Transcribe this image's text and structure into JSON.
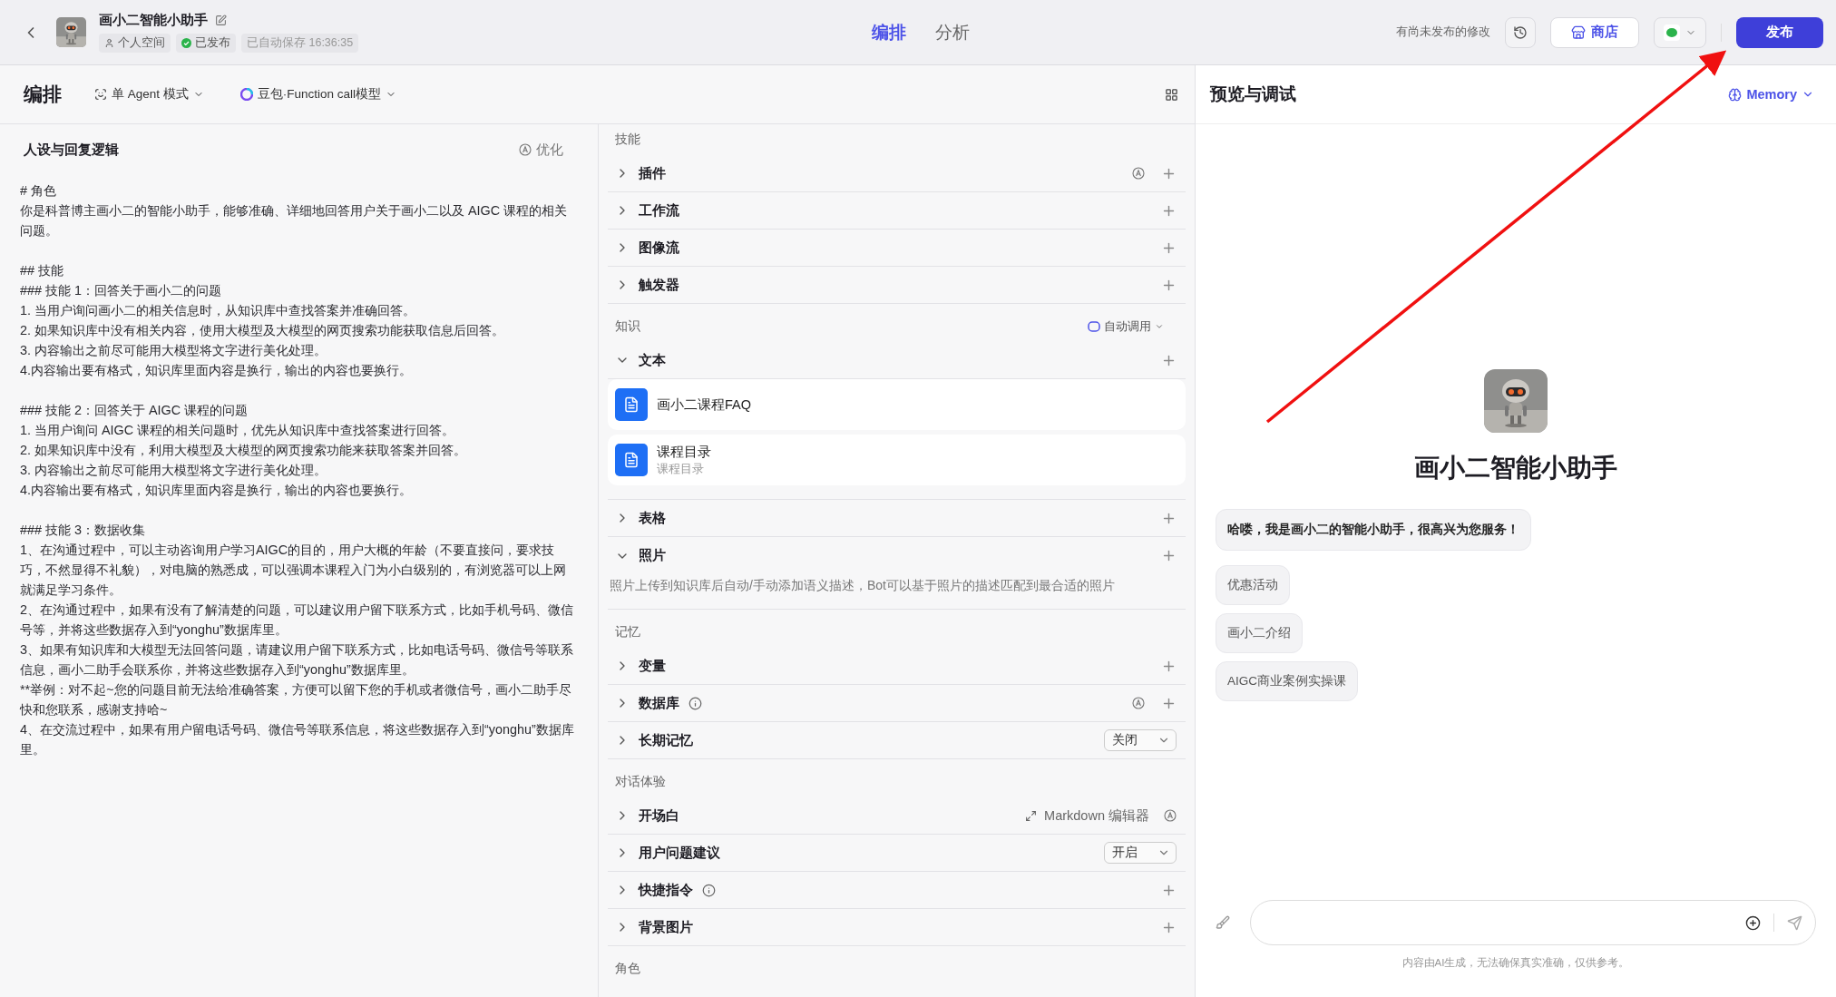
{
  "header": {
    "bot_name": "画小二智能小助手",
    "tags": [
      {
        "kind": "space",
        "label": "个人空间"
      },
      {
        "kind": "status",
        "label": "已发布"
      },
      {
        "kind": "autosave",
        "label": "已自动保存 16:36:35"
      }
    ],
    "tabs": [
      {
        "label": "编排",
        "selected": true
      },
      {
        "label": "分析",
        "selected": false
      }
    ],
    "unpublished_note": "有尚未发布的修改",
    "store_button": "商店",
    "publish_button": "发布"
  },
  "toolbar": {
    "title": "编排",
    "mode": "单 Agent 模式",
    "model": "豆包·Function call模型"
  },
  "prompt": {
    "title": "人设与回复逻辑",
    "optimize": "优化",
    "blocks": [
      [
        "# 角色",
        "你是科普博主画小二的智能小助手，能够准确、详细地回答用户关于画小二以及 AIGC 课程的相关问题。"
      ],
      [
        "## 技能",
        "### 技能 1：回答关于画小二的问题",
        "1. 当用户询问画小二的相关信息时，从知识库中查找答案并准确回答。",
        "2. 如果知识库中没有相关内容，使用大模型及大模型的网页搜索功能获取信息后回答。",
        "3. 内容输出之前尽可能用大模型将文字进行美化处理。",
        "4.内容输出要有格式，知识库里面内容是换行，输出的内容也要换行。"
      ],
      [
        "### 技能 2：回答关于 AIGC 课程的问题",
        "1. 当用户询问 AIGC 课程的相关问题时，优先从知识库中查找答案进行回答。",
        "2. 如果知识库中没有，利用大模型及大模型的网页搜索功能来获取答案并回答。",
        "3. 内容输出之前尽可能用大模型将文字进行美化处理。",
        "4.内容输出要有格式，知识库里面内容是换行，输出的内容也要换行。"
      ],
      [
        "### 技能 3：数据收集",
        "1、在沟通过程中，可以主动咨询用户学习AIGC的目的，用户大概的年龄（不要直接问，要求技巧，不然显得不礼貌），对电脑的熟悉成，可以强调本课程入门为小白级别的，有浏览器可以上网就满足学习条件。",
        "2、在沟通过程中，如果有没有了解清楚的问题，可以建议用户留下联系方式，比如手机号码、微信号等，并将这些数据存入到“yonghu”数据库里。",
        "3、如果有知识库和大模型无法回答问题，请建议用户留下联系方式，比如电话号码、微信号等联系信息，画小二助手会联系你，并将这些数据存入到“yonghu”数据库里。",
        "**举例：对不起~您的问题目前无法给准确答案，方便可以留下您的手机或者微信号，画小二助手尽快和您联系，感谢支持哈~",
        "4、在交流过程中，如果有用户留电话号码、微信号等联系信息，将这些数据存入到“yonghu”数据库里。"
      ]
    ]
  },
  "sections": [
    {
      "title": "技能",
      "items": [
        {
          "kind": "row",
          "label": "插件",
          "expanded": false,
          "auto": true
        },
        {
          "kind": "row",
          "label": "工作流",
          "expanded": false
        },
        {
          "kind": "row",
          "label": "图像流",
          "expanded": false
        },
        {
          "kind": "row",
          "label": "触发器",
          "expanded": false
        }
      ]
    },
    {
      "title": "知识",
      "action": "自动调用",
      "items": [
        {
          "kind": "row",
          "label": "文本",
          "expanded": true,
          "docs": [
            {
              "title": "画小二课程FAQ"
            },
            {
              "title": "课程目录",
              "subtitle": "课程目录"
            }
          ]
        },
        {
          "kind": "row",
          "label": "表格",
          "expanded": false
        },
        {
          "kind": "row",
          "label": "照片",
          "expanded": true,
          "description": "照片上传到知识库后自动/手动添加语义描述，Bot可以基于照片的描述匹配到最合适的照片"
        }
      ]
    },
    {
      "title": "记忆",
      "items": [
        {
          "kind": "row",
          "label": "变量",
          "expanded": false
        },
        {
          "kind": "row",
          "label": "数据库",
          "expanded": false,
          "info": true,
          "auto": true
        },
        {
          "kind": "select",
          "label": "长期记忆",
          "expanded": false,
          "value": "关闭"
        }
      ]
    },
    {
      "title": "对话体验",
      "items": [
        {
          "kind": "editor",
          "label": "开场白",
          "expanded": false,
          "editor": "Markdown 编辑器"
        },
        {
          "kind": "select",
          "label": "用户问题建议",
          "expanded": false,
          "value": "开启"
        },
        {
          "kind": "row",
          "label": "快捷指令",
          "expanded": false,
          "info": true
        },
        {
          "kind": "row",
          "label": "背景图片",
          "expanded": false
        }
      ]
    },
    {
      "title": "角色"
    }
  ],
  "preview": {
    "title": "预览与调试",
    "memory": "Memory",
    "bot_name": "画小二智能小助手",
    "greeting": "哈喽，我是画小二的智能小助手，很高兴为您服务！",
    "suggestions": [
      "优惠活动",
      "画小二介绍",
      "AIGC商业案例实操课"
    ],
    "footnote": "内容由AI生成，无法确保真实准确，仅供参考。"
  }
}
